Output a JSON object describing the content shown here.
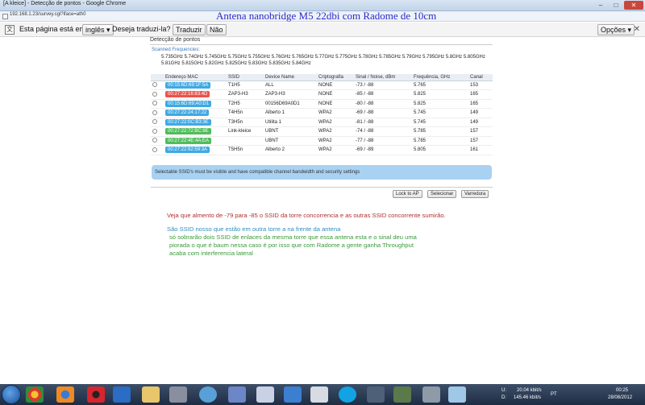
{
  "window": {
    "title": "[A kleice] - Detecção de pontos - Google Chrome",
    "minimize": "–",
    "maximize": "□",
    "close": "✕"
  },
  "address": {
    "url": "192.168.1.23/survey.cgi?iface=ath0"
  },
  "overlay_title": "Antena nanobridge M5 22dbi com Radome de 10cm",
  "translate_bar": {
    "prompt": "Esta página está em",
    "language": "inglês ▾",
    "question": "Deseja traduzi-la?",
    "translate_button": "Traduzir",
    "no_button": "Não",
    "options_button": "Opções ▾"
  },
  "page": {
    "section_title": "Detecção de pontos",
    "scanned_label": "Scanned Frequencies:",
    "frequencies_line1": "5.735GHz 5.74GHz 5.745GHz 5.75GHz 5.755GHz 5.76GHz 5.765GHz 5.77GHz 5.775GHz 5.78GHz 5.785GHz 5.79GHz 5.795GHz 5.8GHz 5.805GHz",
    "frequencies_line2": "5.81GHz 5.815GHz 5.82GHz 5.825GHz 5.83GHz 5.835GHz 5.84GHz",
    "columns": {
      "mac": "Endereço MAC",
      "ssid": "SSID",
      "device": "Device Name",
      "crypto": "Criptografia",
      "signal": "Sinal / Noise, dBm",
      "freq": "Frequência, GHz",
      "channel": "Canal"
    },
    "rows": [
      {
        "mac": "00:15:6D:69:1F:5A",
        "ssid": "T1H5",
        "device": "ALL",
        "crypto": "NONE",
        "signal": "-73 / -88",
        "freq": "5.765",
        "channel": "153",
        "color": "#2aa0e0"
      },
      {
        "mac": "00:27:22:16:83:4D",
        "ssid": "ZAP3-H3",
        "device": "ZAP3-H3",
        "crypto": "NONE",
        "signal": "-85 / -88",
        "freq": "5.825",
        "channel": "165",
        "color": "#e8413a"
      },
      {
        "mac": "00:15:6D:69:A0:D1",
        "ssid": "T2H5",
        "device": "00156D69A0D1",
        "crypto": "NONE",
        "signal": "-80 / -88",
        "freq": "5.825",
        "channel": "165",
        "color": "#2aa0e0"
      },
      {
        "mac": "00:27:22:24:17:22",
        "ssid": "T4H5n",
        "device": "Alberto 1",
        "crypto": "WPA2",
        "signal": "-69 / -88",
        "freq": "5.745",
        "channel": "149",
        "color": "#2aa0e0"
      },
      {
        "mac": "00:27:22:0C:B3:3E",
        "ssid": "T3H5n",
        "device": "Utilita 1",
        "crypto": "WPA2",
        "signal": "-81 / -88",
        "freq": "5.745",
        "channel": "149",
        "color": "#2aa0e0"
      },
      {
        "mac": "00:27:22:72:BC:8E",
        "ssid": "Link-kleice",
        "device": "UBNT",
        "crypto": "WPA2",
        "signal": "-74 / -88",
        "freq": "5.785",
        "channel": "157",
        "color": "#3cb54a"
      },
      {
        "mac": "00:27:22:4E:4A:EA",
        "ssid": "",
        "device": "UBNT",
        "crypto": "WPA2",
        "signal": "-77 / -88",
        "freq": "5.785",
        "channel": "157",
        "color": "#3cb54a"
      },
      {
        "mac": "00:27:22:92:59:3A",
        "ssid": "T5H5n",
        "device": "Alberto 2",
        "crypto": "WPA2",
        "signal": "-69 / -89",
        "freq": "5.805",
        "channel": "161",
        "color": "#2aa0e0"
      }
    ],
    "info_text": "Selectable SSID's must be visible and have compatible channel bandwidth and security settings",
    "buttons": {
      "lock": "Lock to AP",
      "select": "Selecionar",
      "scan": "Varredura"
    }
  },
  "notes": {
    "red": "Veja que almento  de -79 para -85 o SSID da torre concorrencia e as outras SSID concorrente sumirão.",
    "blue": "São SSID nosso que estão em outra torre a na frente da antena",
    "green1": "só sobrarão dois SSID de enlaces da mesma torre que essa antena esta e o sinal deu uma",
    "green2": "piorada o que é baum nessa caso é por isso que com Radome a  gente ganha Throughput",
    "green3": "acaba com interferencia lateral"
  },
  "taskbar": {
    "net_up": "20.04 kbit/s",
    "net_down": "145.46 kbit/s",
    "net_u_label": "U:",
    "net_d_label": "D:",
    "lang": "PT",
    "time": "00:25",
    "date": "28/08/2012"
  },
  "icons": [
    "chrome-icon",
    "firefox-icon",
    "opera-icon",
    "media-player-icon",
    "folder-icon",
    "skype-icon"
  ]
}
